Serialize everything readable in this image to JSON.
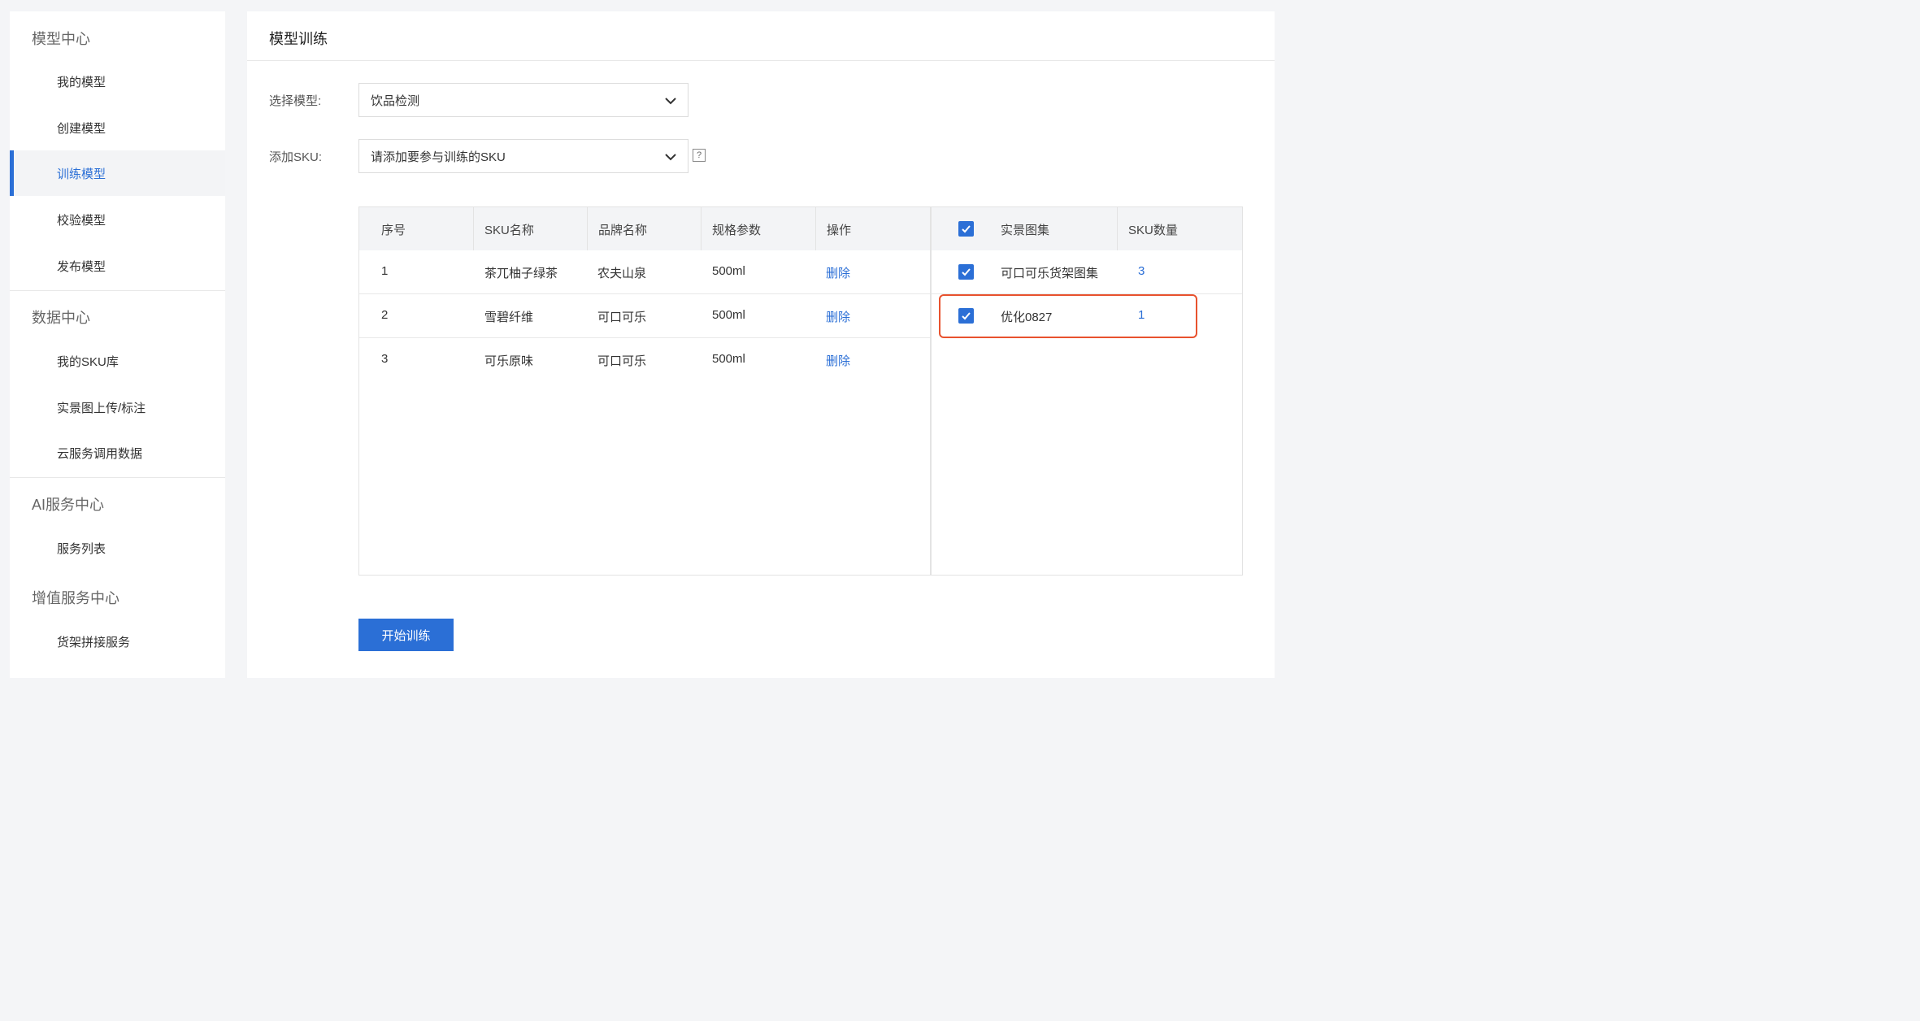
{
  "sidebar": {
    "groups": [
      {
        "title": "模型中心",
        "items": [
          "我的模型",
          "创建模型",
          "训练模型",
          "校验模型",
          "发布模型"
        ]
      },
      {
        "title": "数据中心",
        "items": [
          "我的SKU库",
          "实景图上传/标注",
          "云服务调用数据"
        ]
      },
      {
        "title": "AI服务中心",
        "items": [
          "服务列表"
        ]
      },
      {
        "title": "增值服务中心",
        "items": [
          "货架拼接服务"
        ]
      }
    ],
    "active_item": "训练模型"
  },
  "page": {
    "title": "模型训练"
  },
  "form": {
    "model_label": "选择模型:",
    "model_value": "饮品检测",
    "sku_label": "添加SKU:",
    "sku_placeholder": "请添加要参与训练的SKU",
    "help_icon": "?"
  },
  "sku_table": {
    "columns": [
      "序号",
      "SKU名称",
      "品牌名称",
      "规格参数",
      "操作"
    ],
    "rows": [
      {
        "index": "1",
        "name": "茶兀柚子绿茶",
        "brand": "农夫山泉",
        "spec": "500ml",
        "action": "删除"
      },
      {
        "index": "2",
        "name": "雪碧纤维",
        "brand": "可口可乐",
        "spec": "500ml",
        "action": "删除"
      },
      {
        "index": "3",
        "name": "可乐原味",
        "brand": "可口可乐",
        "spec": "500ml",
        "action": "删除"
      }
    ]
  },
  "gallery_table": {
    "columns": [
      "实景图集",
      "SKU数量"
    ],
    "header_checked": true,
    "rows": [
      {
        "checked": true,
        "name": "可口可乐货架图集",
        "count": "3"
      },
      {
        "checked": true,
        "name": "优化0827",
        "count": "1"
      }
    ]
  },
  "actions": {
    "start_training": "开始训练"
  },
  "colors": {
    "accent": "#2b6fd6",
    "highlight": "#e8522e"
  }
}
